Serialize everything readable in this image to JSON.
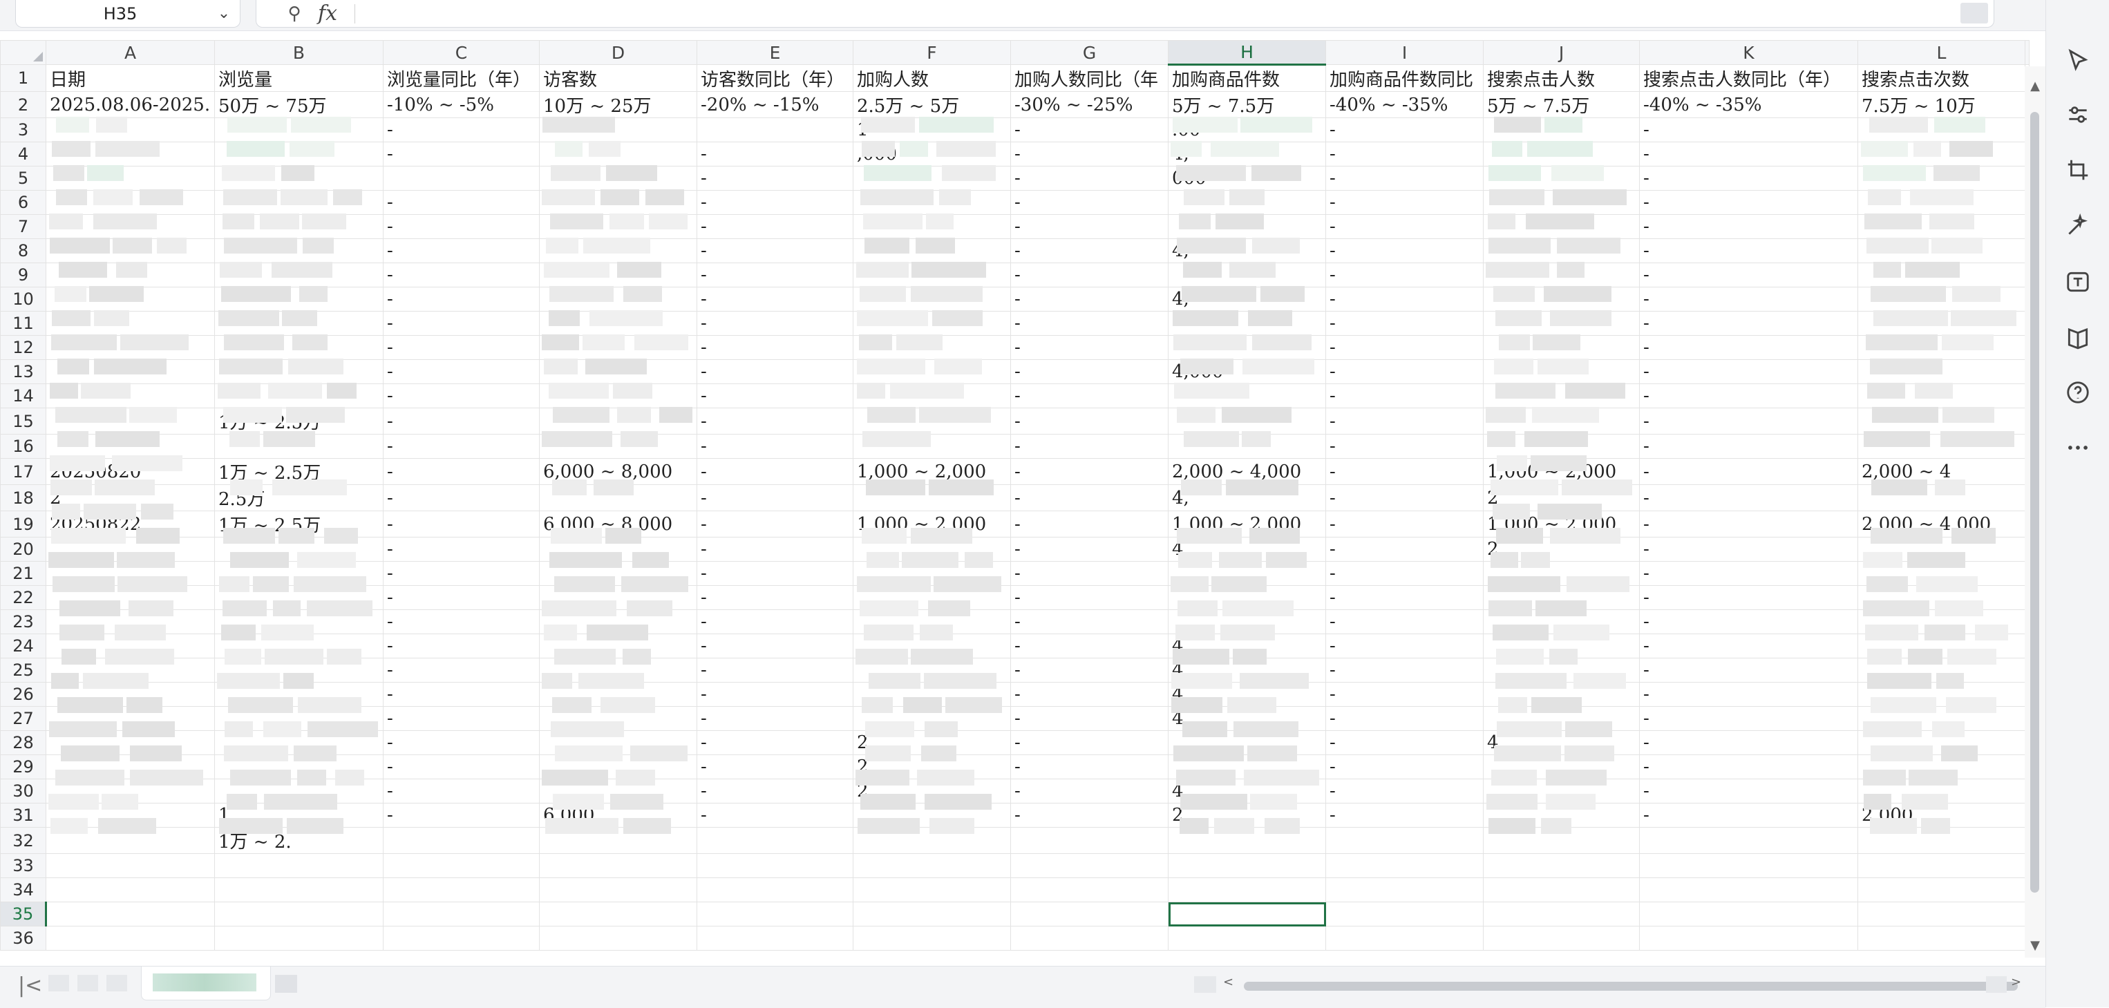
{
  "formula_bar": {
    "name_box": "H35",
    "fx_label": "fx",
    "formula": ""
  },
  "columns": [
    "A",
    "B",
    "C",
    "D",
    "E",
    "F",
    "G",
    "H",
    "I",
    "J",
    "K",
    "L"
  ],
  "selected_column": "H",
  "selected_row": 35,
  "row_numbers": [
    "1",
    "2",
    "3",
    "4",
    "5",
    "6",
    "7",
    "8",
    "9",
    "10",
    "11",
    "12",
    "13",
    "14",
    "15",
    "16",
    "17",
    "18",
    "19",
    "20",
    "21",
    "22",
    "23",
    "24",
    "25",
    "26",
    "27",
    "28",
    "29",
    "30",
    "31",
    "32",
    "33",
    "34",
    "35",
    "36"
  ],
  "rows": [
    [
      "日期",
      "浏览量",
      "浏览量同比（年）",
      "访客数",
      "访客数同比（年）",
      "加购人数",
      "加购人数同比（年",
      "加购商品件数",
      "加购商品件数同比",
      "搜索点击人数",
      "搜索点击人数同比（年）",
      "搜索点击次数"
    ],
    [
      "2025.08.06-2025.",
      "50万 ~ 75万",
      "-10% ~ -5%",
      "10万 ~ 25万",
      "-20% ~ -15%",
      "2.5万 ~ 5万",
      "-30% ~ -25%",
      "5万 ~ 7.5万",
      "-40% ~ -35%",
      "5万 ~ 7.5万",
      "-40% ~ -35%",
      "7.5万 ~ 10万"
    ],
    [
      "",
      "",
      "-",
      "",
      "",
      "1",
      "-",
      ".00",
      "-",
      "",
      "-",
      ""
    ],
    [
      "",
      "",
      "-",
      "",
      "-",
      ",000",
      "-",
      "4,",
      "-",
      "",
      "-",
      ""
    ],
    [
      "",
      "",
      "",
      "",
      "-",
      "",
      "-",
      "000",
      "-",
      "",
      "-",
      ""
    ],
    [
      "",
      "",
      "-",
      "",
      "-",
      "",
      "-",
      "",
      "-",
      "",
      "-",
      ""
    ],
    [
      "",
      "",
      "-",
      "",
      "-",
      "",
      "-",
      "",
      "-",
      "",
      "-",
      ""
    ],
    [
      "",
      "",
      "-",
      "",
      "-",
      "",
      "-",
      "4,",
      "-",
      "",
      "-",
      ""
    ],
    [
      "",
      "",
      "-",
      "",
      "-",
      "",
      "-",
      "",
      "-",
      "",
      "-",
      ""
    ],
    [
      "",
      "",
      "-",
      "",
      "-",
      "",
      "-",
      "4,",
      "-",
      "",
      "-",
      ""
    ],
    [
      "",
      "",
      "-",
      "",
      "-",
      "",
      "-",
      "",
      "-",
      "",
      "-",
      ""
    ],
    [
      "",
      "",
      "-",
      "",
      "-",
      "",
      "-",
      "",
      "-",
      "",
      "-",
      ""
    ],
    [
      "",
      "",
      "-",
      "",
      "-",
      "",
      "-",
      "4,000",
      "-",
      "",
      "-",
      ""
    ],
    [
      "",
      "",
      "-",
      "",
      "-",
      "",
      "-",
      "",
      "-",
      "",
      "-",
      ""
    ],
    [
      "",
      "1万 ~ 2.5万",
      "-",
      "",
      "-",
      "",
      "-",
      "",
      "-",
      "",
      "-",
      ""
    ],
    [
      "",
      "",
      "-",
      "",
      "-",
      "",
      "-",
      "",
      "-",
      "",
      "-",
      ""
    ],
    [
      "20250820",
      "1万 ~ 2.5万",
      "-",
      "6,000 ~ 8,000",
      "-",
      "1,000 ~ 2,000",
      "-",
      "2,000 ~ 4,000",
      "-",
      "1,000 ~ 2,000",
      "-",
      "2,000 ~ 4"
    ],
    [
      "2",
      "2.5万",
      "-",
      "",
      "-",
      "",
      "-",
      "4,",
      "-",
      "2",
      "-",
      ""
    ],
    [
      "20250822",
      "1万 ~ 2.5万",
      "-",
      "6,000 ~ 8,000",
      "-",
      "1,000 ~ 2,000",
      "-",
      "1,000 ~ 2,000",
      "-",
      "1,000 ~ 2,000",
      "-",
      "2,000 ~ 4,000"
    ],
    [
      "",
      "",
      "-",
      "",
      "-",
      "",
      "-",
      "4",
      "-",
      "2",
      "-",
      ""
    ],
    [
      "",
      "",
      "-",
      "",
      "-",
      "",
      "-",
      "",
      "-",
      "",
      "-",
      ""
    ],
    [
      "",
      "",
      "-",
      "",
      "-",
      "",
      "-",
      "",
      "-",
      "",
      "-",
      ""
    ],
    [
      "",
      "",
      "-",
      "",
      "-",
      "",
      "-",
      "",
      "-",
      "",
      "-",
      ""
    ],
    [
      "",
      "",
      "-",
      "",
      "-",
      "",
      "-",
      "4,",
      "-",
      "",
      "-",
      ""
    ],
    [
      "",
      "",
      "-",
      "",
      "-",
      "",
      "-",
      "4,",
      "-",
      "",
      "-",
      ""
    ],
    [
      "",
      "",
      "-",
      "",
      "-",
      "",
      "-",
      "4,",
      "-",
      "",
      "-",
      ""
    ],
    [
      "",
      "",
      "-",
      "",
      "-",
      "",
      "-",
      "4",
      "-",
      "",
      "-",
      ""
    ],
    [
      "",
      "",
      "-",
      "",
      "-",
      "2,",
      "-",
      "",
      "-",
      "4",
      "-",
      ""
    ],
    [
      "",
      "",
      "-",
      "",
      "-",
      "2",
      "-",
      "",
      "-",
      "",
      "-",
      ""
    ],
    [
      "",
      "",
      "-",
      "",
      "-",
      "2.",
      "-",
      "4,",
      "-",
      "",
      "-",
      ""
    ],
    [
      "",
      "1",
      "-",
      "6,000",
      "-",
      "",
      "-",
      "2",
      "-",
      "",
      "-",
      "2,000"
    ],
    [
      "",
      "1万 ~ 2.",
      "",
      "",
      "",
      "",
      "",
      "",
      "",
      "",
      "",
      ""
    ],
    [
      "",
      "",
      "",
      "",
      "",
      "",
      "",
      "",
      "",
      "",
      "",
      ""
    ],
    [
      "",
      "",
      "",
      "",
      "",
      "",
      "",
      "",
      "",
      "",
      "",
      ""
    ],
    [
      "",
      "",
      "",
      "",
      "",
      "",
      "",
      "",
      "",
      "",
      "",
      ""
    ],
    [
      "",
      "",
      "",
      "",
      "",
      "",
      "",
      "",
      "",
      "",
      "",
      ""
    ]
  ],
  "sheet_bar": {
    "first_label": "|<",
    "prev_label": "<",
    "next_label": ">"
  },
  "scroll": {
    "up_label": "▲",
    "down_label": "▼"
  }
}
